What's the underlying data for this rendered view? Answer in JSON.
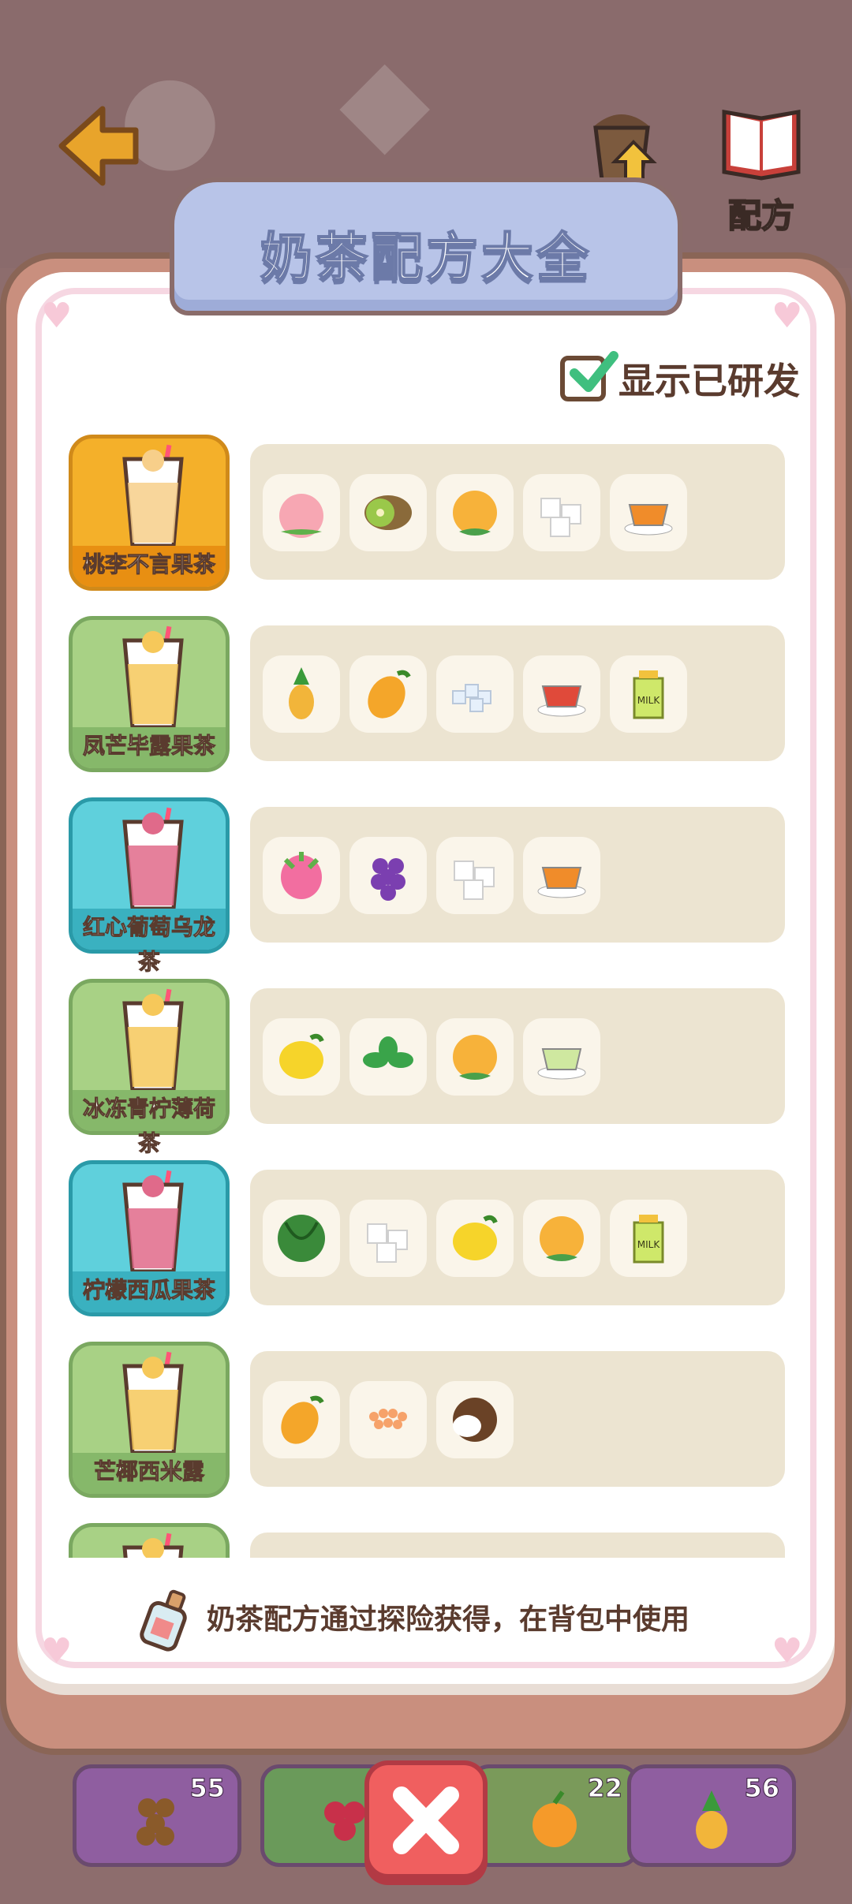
{
  "title": "奶茶配方大全",
  "top_nav": {
    "upgrade_label": "升级",
    "recipe_label": "配方"
  },
  "toggle": {
    "label": "显示已研发",
    "checked": true
  },
  "recipes": [
    {
      "name": "桃李不言果茶",
      "theme": "#f4b02a",
      "ingredients": [
        "peach-icon",
        "kiwi-icon",
        "orange-icon",
        "sugar-cube-icon",
        "black-tea-icon"
      ]
    },
    {
      "name": "凤芒毕露果茶",
      "theme": "#a8d185",
      "ingredients": [
        "pineapple-icon",
        "mango-icon",
        "rock-sugar-icon",
        "red-tea-icon",
        "milk-carton-icon"
      ]
    },
    {
      "name": "红心葡萄乌龙茶",
      "theme": "#5fd0dc",
      "ingredients": [
        "dragon-fruit-icon",
        "grape-icon",
        "sugar-cube-icon",
        "black-tea-icon"
      ]
    },
    {
      "name": "冰冻青柠薄荷茶",
      "theme": "#a8d185",
      "ingredients": [
        "lemon-icon",
        "mint-icon",
        "orange-icon",
        "green-tea-icon"
      ]
    },
    {
      "name": "柠檬西瓜果茶",
      "theme": "#5fd0dc",
      "ingredients": [
        "watermelon-icon",
        "sugar-cube-icon",
        "lemon-icon",
        "orange-icon",
        "milk-carton-icon"
      ]
    },
    {
      "name": "芒椰西米露",
      "theme": "#a8d185",
      "ingredients": [
        "mango-icon",
        "tapioca-pearls-icon",
        "coconut-icon"
      ]
    },
    {
      "name": "",
      "theme": "#a8d185",
      "ingredients": []
    }
  ],
  "footer_note": "奶茶配方通过探险获得，在背包中使用",
  "inventory": [
    {
      "item": "tapioca-icon",
      "count": "55"
    },
    {
      "item": "raspberry-icon",
      "count": ""
    },
    {
      "item": "orange-icon",
      "count": "22"
    },
    {
      "item": "pineapple-icon",
      "count": "56"
    }
  ]
}
